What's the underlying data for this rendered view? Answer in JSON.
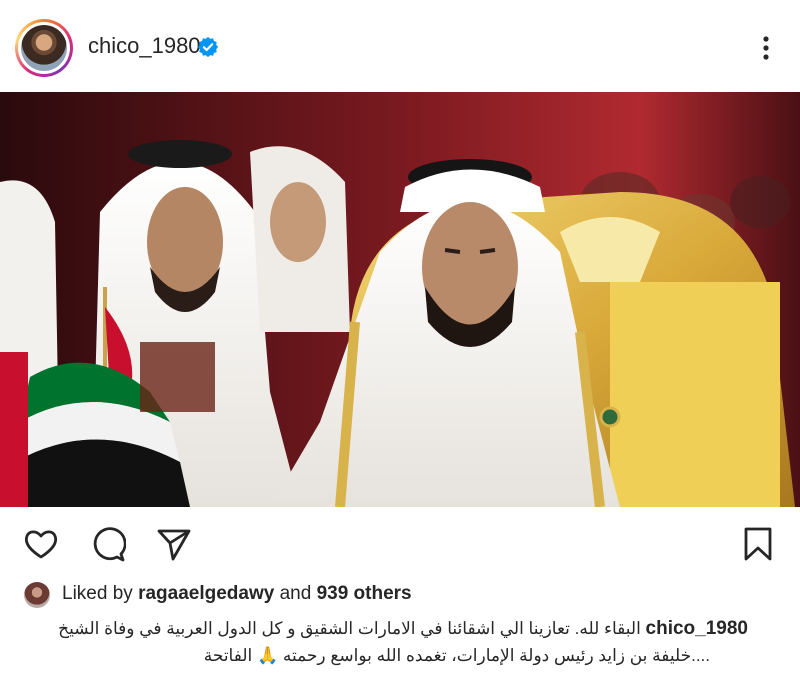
{
  "post": {
    "username": "chico_1980",
    "verified": true,
    "likes": {
      "prefix": "Liked by",
      "liker": "ragaaelgedawy",
      "connector": "and",
      "others": "939 others"
    },
    "caption": {
      "user": "chico_1980",
      "line1": "البقاء لله. تعازينا  الي اشقائنا في الامارات الشقيق و كل الدول العربية في وفاة الشيخ",
      "line2": "....خليفة بن زايد رئيس دولة الإمارات، تغمده الله بواسع رحمته 🙏 الفاتحة"
    }
  },
  "icons": {
    "avatar": "profile-avatar",
    "verified": "verified-badge-icon",
    "more": "more-options-icon",
    "like": "heart-icon",
    "comment": "comment-bubble-icon",
    "share": "paper-plane-icon",
    "save": "bookmark-icon"
  },
  "colors": {
    "verified": "#0095f6",
    "text": "#262626",
    "background": "#ffffff",
    "photo_bg": "#3a0d10",
    "throne_gold": "#d9b44a"
  }
}
